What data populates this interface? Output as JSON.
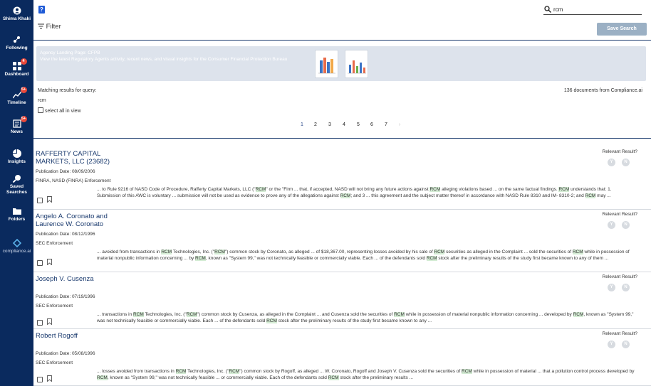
{
  "sidebar": {
    "user": "Shima Khaki",
    "items": [
      {
        "label": "Following",
        "icon": "following-icon"
      },
      {
        "label": "Dashboard",
        "icon": "dashboard-icon",
        "badge": "4"
      },
      {
        "label": "Timeline",
        "icon": "timeline-icon",
        "badge": "5+"
      },
      {
        "label": "News",
        "icon": "news-icon",
        "badge": "5+"
      },
      {
        "label": "Insights",
        "icon": "insights-icon"
      },
      {
        "label": "Saved Searches",
        "icon": "saved-searches-icon"
      },
      {
        "label": "Folders",
        "icon": "folder-icon"
      }
    ],
    "brand": "compliance.ai"
  },
  "header": {
    "help": "?",
    "search_value": "rcm",
    "filter_label": "Filter",
    "save_search_label": "Save Search"
  },
  "banner": {
    "title": "Agency Landing Page: CFPB",
    "subtitle": "View the latest Regulatory Agents activity, recent news, and visual insights for the Consumer Financial Protection Bureau"
  },
  "results_meta": {
    "matching_label": "Matching results for query:",
    "query": "rcm",
    "doc_count": "136 documents from Compliance.ai",
    "select_all": "select all in view",
    "pages": [
      "1",
      "2",
      "3",
      "4",
      "5",
      "6",
      "7"
    ],
    "current_page": "1",
    "next": "›"
  },
  "relevant_label": "Relevant Result?",
  "yes_label": "Y",
  "no_label": "N",
  "results": [
    {
      "title": "RAFFERTY CAPITAL MARKETS, LLC (23682)",
      "date": "Publication Date: 08/09/2006",
      "source": "FINRA, NASD (FINRA) Enforcement",
      "snippet": "... to Rule 9216 of NASD Code of Procedure, Rafferty Capital Markets, LLC (\"RCM\" or the \"Firm ... that, if accepted, NASD will not bring any future actions against RCM alleging violations based ... on the same factual findings. RCM understands that: 1. Submission of this AWC is voluntary ... submission will not be used as evidence to prove any of the allegations against RCM; and 3 ... this agreement and the subject matter thereof in accordance with NASD Rule 8310 and IM- 8310-2; and RCM may ..."
    },
    {
      "title": "Angelo A. Coronato and Laurence W. Coronato",
      "date": "Publication Date: 08/12/1996",
      "source": "SEC Enforcement",
      "snippet": "... avoided from transactions in RCM Technologies, Inc. (\"RCM\") common stock by Coronato, as alleged ... of $18,367.00, representing losses avoided by his sale of RCM securities as alleged in the Complaint ... sold the securities of RCM while in possession of material nonpublic information concerning ... by RCM, known as \"System 99,\" was not technically feasible or commercially viable. Each ... of the defendants sold RCM stock after the preliminary results of the study first became known to any of them ..."
    },
    {
      "title": "Joseph V. Cusenza",
      "date": "Publication Date: 07/19/1996",
      "source": "SEC Enforcement",
      "snippet": "... transactions in RCM Technologies, Inc. (\"RCM\") common stock by Cusenza, as alleged in the Complaint ... and Cusenza sold the securities of RCM while in possession of material nonpublic information concerning ... developed by RCM, known as \"System 99,\" was not technically feasible or commercially viable. Each ... of the defendants sold RCM stock after the preliminary results of the study first became known to any ..."
    },
    {
      "title": "Robert Rogoff",
      "date": "Publication Date: 05/08/1996",
      "source": "SEC Enforcement",
      "snippet": "... losses avoided from transactions in RCM Technologies, Inc. (\"RCM\") common stock by Rogoff, as alleged ... W. Coronato, Rogoff and Joseph V. Cusenza sold the securities of RCM while in possession of material ... that a pollution control process developed by RCM, known as \"System 99,\" was not technically feasible ... or commercially viable. Each of the defendants sold RCM stock after the preliminary results ..."
    }
  ]
}
